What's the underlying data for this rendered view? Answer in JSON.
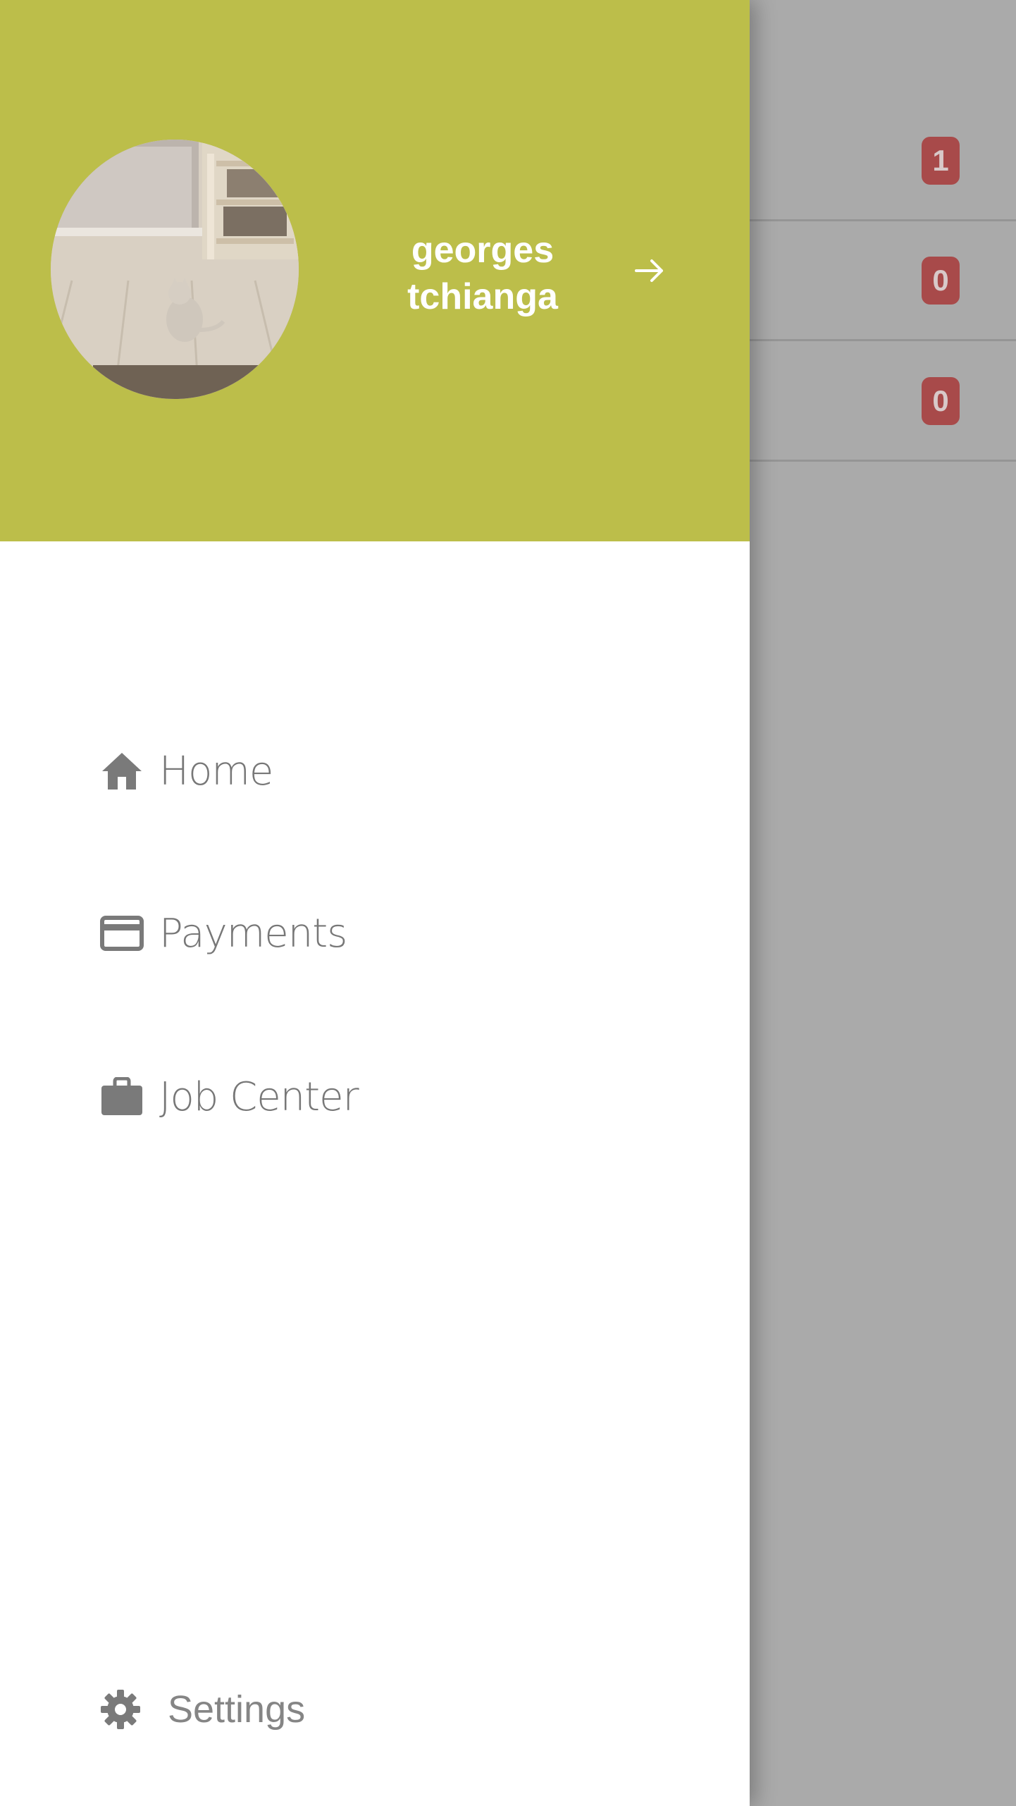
{
  "background_list": {
    "badges": [
      "1",
      "0",
      "0"
    ]
  },
  "drawer": {
    "header": {
      "user_name_line1": "georges",
      "user_name_line2": "tchianga",
      "avatar_icon": "user-photo-cat",
      "arrow_icon": "arrow-right-icon",
      "background_color": "#bcbe4a"
    },
    "menu": [
      {
        "label": "Home",
        "icon": "home-icon"
      },
      {
        "label": "Payments",
        "icon": "credit-card-icon"
      },
      {
        "label": "Job Center",
        "icon": "briefcase-icon"
      }
    ],
    "settings": {
      "label": "Settings",
      "icon": "gear-icon"
    }
  },
  "colors": {
    "badge": "#a84a4a",
    "menu_text": "#777777",
    "overlay": "#aaaaaa"
  }
}
